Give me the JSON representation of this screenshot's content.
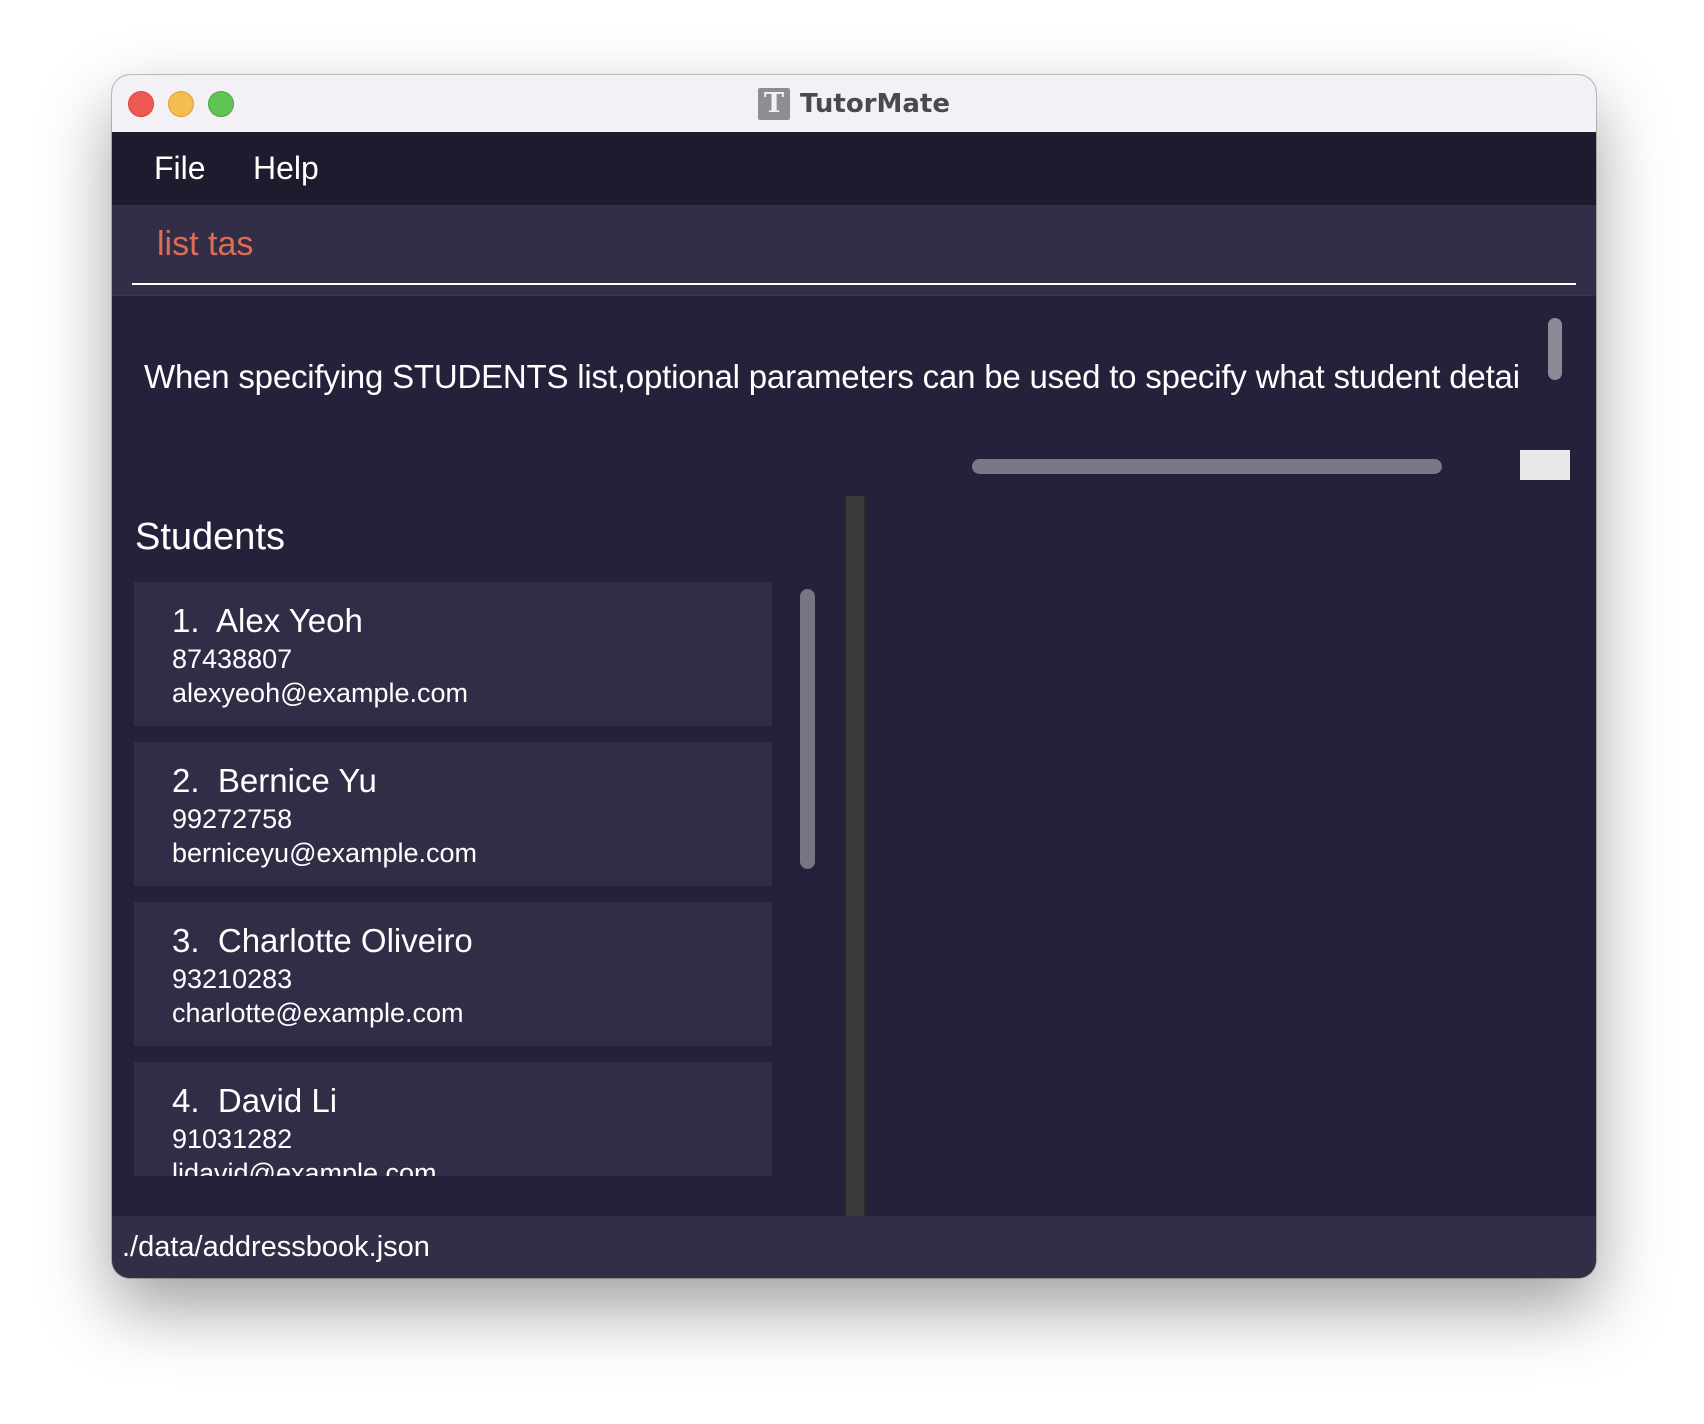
{
  "window": {
    "title": "TutorMate",
    "app_icon_letter": "T"
  },
  "menu": {
    "file_label": "File",
    "help_label": "Help"
  },
  "command": {
    "value": "list tas",
    "color": "#e26b55"
  },
  "result": {
    "text": "When specifying STUDENTS list,optional parameters can be used to specify what student detai"
  },
  "students": {
    "heading": "Students",
    "items": [
      {
        "name": "1.  Alex Yeoh",
        "phone": "87438807",
        "email": "alexyeoh@example.com"
      },
      {
        "name": "2.  Bernice Yu",
        "phone": "99272758",
        "email": "berniceyu@example.com"
      },
      {
        "name": "3.  Charlotte Oliveiro",
        "phone": "93210283",
        "email": "charlotte@example.com"
      },
      {
        "name": "4.  David Li",
        "phone": "91031282",
        "email": "lidavid@example.com"
      }
    ]
  },
  "status": {
    "path": "./data/addressbook.json"
  },
  "colors": {
    "background": "#24223a",
    "menubar": "#1d1b2d",
    "card": "#322d47",
    "accent": "#e26b55"
  }
}
